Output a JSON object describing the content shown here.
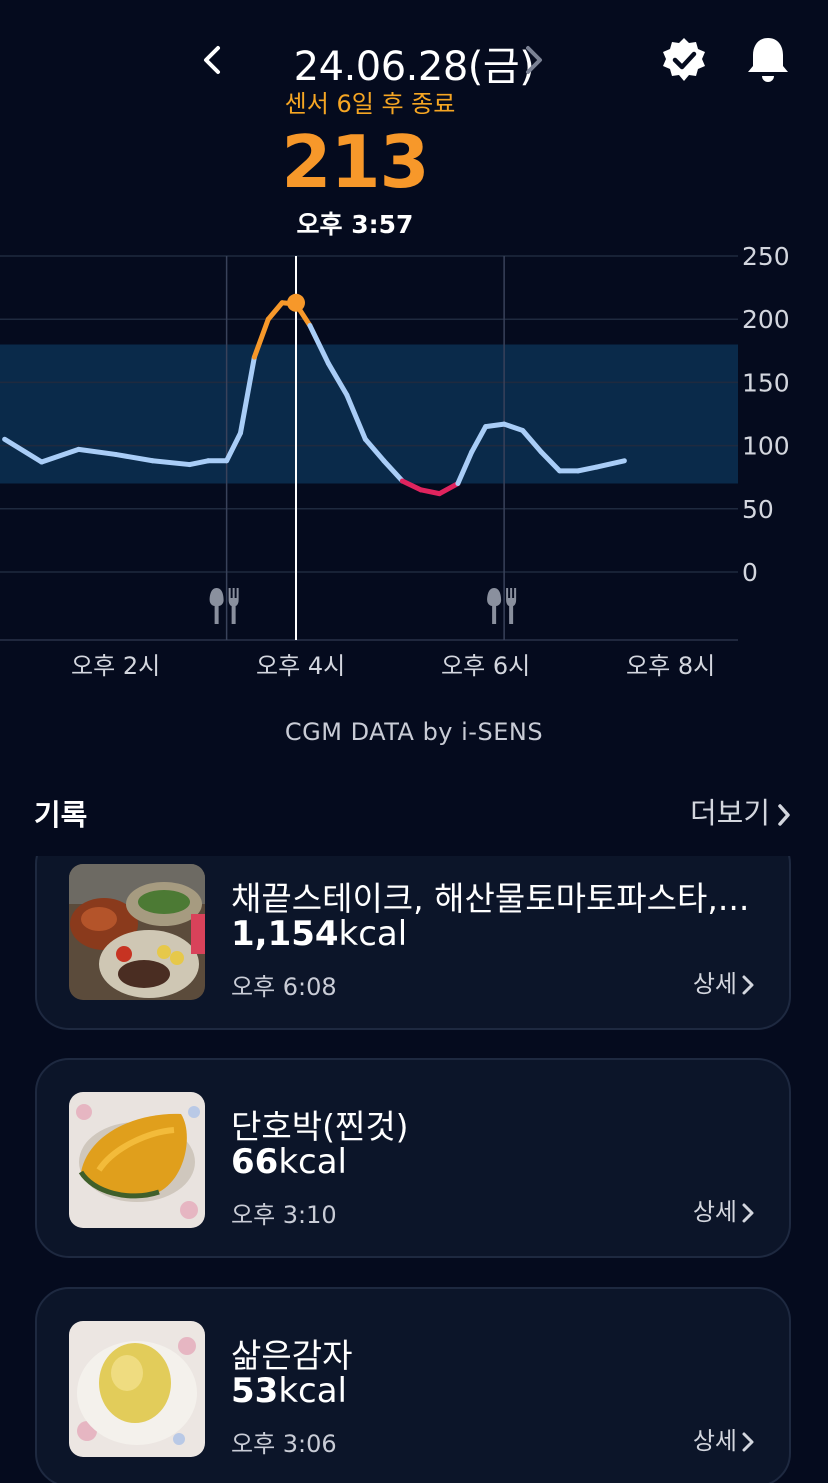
{
  "header": {
    "date": "24.06.28(금)",
    "sensor_status": "센서 6일 후 종료",
    "prev_icon": "chevron-left-icon",
    "next_icon": "chevron-right-icon",
    "verify_icon": "verified-badge-icon",
    "bell_icon": "bell-icon"
  },
  "current": {
    "value": "213",
    "time": "오후 3:57"
  },
  "colors": {
    "background": "#050b1e",
    "accent_orange": "#f7982a",
    "sensor_text": "#f6a623",
    "line_normal": "#a9cdf7",
    "line_high": "#f7982a",
    "line_low": "#e0245e",
    "target_band": "#0a2a4a",
    "card_bg": "#0c1529"
  },
  "chart_data": {
    "type": "line",
    "yticks": [
      "250",
      "200",
      "150",
      "100",
      "50",
      "0"
    ],
    "ylim": [
      0,
      250
    ],
    "target_range": [
      70,
      180
    ],
    "high_threshold": 180,
    "low_threshold": 70,
    "xticks": [
      "오후 2시",
      "오후 4시",
      "오후 6시",
      "오후 8시"
    ],
    "x_hours": [
      12.8,
      13.2,
      13.6,
      14.0,
      14.4,
      14.8,
      15.0,
      15.2,
      15.35,
      15.5,
      15.65,
      15.8,
      15.95,
      16.1,
      16.3,
      16.5,
      16.7,
      16.9,
      17.1,
      17.3,
      17.5,
      17.7,
      17.85,
      18.0,
      18.2,
      18.4,
      18.6,
      18.8,
      19.0,
      19.2,
      19.5
    ],
    "values": [
      105,
      87,
      97,
      93,
      88,
      85,
      88,
      88,
      110,
      170,
      200,
      213,
      212,
      195,
      165,
      140,
      105,
      88,
      72,
      65,
      62,
      70,
      95,
      115,
      117,
      112,
      95,
      80,
      80,
      83,
      88
    ],
    "current_point": {
      "x_hour": 15.95,
      "value": 213
    },
    "meal_markers_hours": [
      15.2,
      18.2
    ],
    "meal_icon": "fork-knife-icon"
  },
  "credit": "CGM DATA by i-SENS",
  "records": {
    "title": "기록",
    "more_label": "더보기",
    "items": [
      {
        "name": "채끝스테이크, 해산물토마토파스타,...",
        "kcal_num": "1,154",
        "kcal_unit": "kcal",
        "time": "오후 6:08",
        "detail": "상세"
      },
      {
        "name": "단호박(찐것)",
        "kcal_num": "66",
        "kcal_unit": "kcal",
        "time": "오후 3:10",
        "detail": "상세"
      },
      {
        "name": "삶은감자",
        "kcal_num": "53",
        "kcal_unit": "kcal",
        "time": "오후 3:06",
        "detail": "상세"
      }
    ]
  }
}
